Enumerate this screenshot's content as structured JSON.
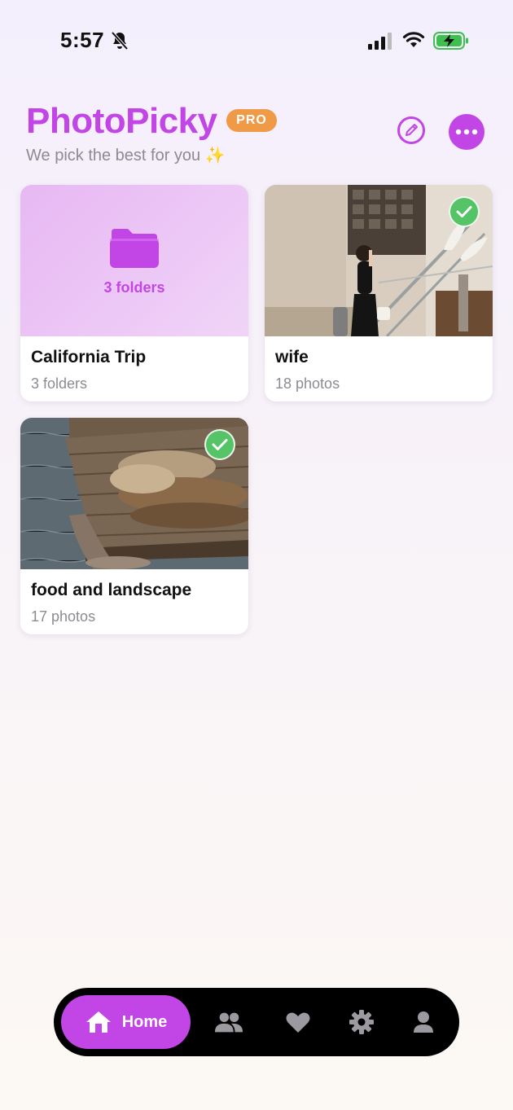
{
  "status_bar": {
    "time": "5:57",
    "icons": [
      "bell-slash-icon",
      "cellular-signal-icon",
      "wifi-icon",
      "battery-charging-icon"
    ]
  },
  "header": {
    "title": "PhotoPicky",
    "badge": "PRO",
    "subtitle": "We pick the best for you ✨",
    "actions": [
      "edit-icon",
      "more-icon"
    ]
  },
  "albums": [
    {
      "title": "California Trip",
      "subtitle": "3 folders",
      "cover_label": "3 folders",
      "type": "folder",
      "checked": false
    },
    {
      "title": "wife",
      "subtitle": "18 photos",
      "type": "photo",
      "checked": true
    },
    {
      "title": "food and landscape",
      "subtitle": "17 photos",
      "type": "photo",
      "checked": true
    }
  ],
  "tab_bar": {
    "home_label": "Home",
    "tabs": [
      "home-icon",
      "people-icon",
      "heart-icon",
      "gear-icon",
      "person-icon"
    ]
  },
  "colors": {
    "accent": "#c246e6",
    "badge": "#ef9a47",
    "check": "#54c466",
    "muted_text": "#8e8a92"
  }
}
